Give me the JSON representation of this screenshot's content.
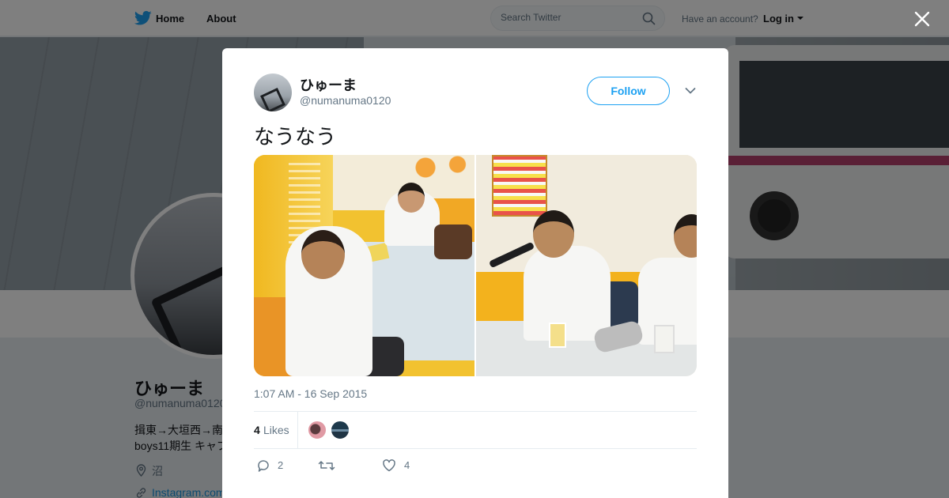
{
  "nav": {
    "home_label": "Home",
    "about_label": "About",
    "search_placeholder": "Search Twitter",
    "have_account": "Have an account?",
    "login_label": "Log in"
  },
  "profile": {
    "name": "ひゅーま",
    "handle": "@numanuma0120",
    "bio_line1": "揖東→大垣西→南",
    "bio_line2": "boys11期生 キャプ",
    "location": "沼",
    "link": "Instagram.com"
  },
  "tweet": {
    "author_name": "ひゅーま",
    "author_handle": "@numanuma0120",
    "follow_label": "Follow",
    "text": "なうなう",
    "timestamp": "1:07 AM - 16 Sep 2015",
    "likes_count": "4",
    "likes_label": "Likes",
    "reply_count": "2",
    "like_count": "4"
  },
  "colors": {
    "accent": "#1da1f2",
    "text_primary": "#14171a",
    "text_secondary": "#657786"
  }
}
